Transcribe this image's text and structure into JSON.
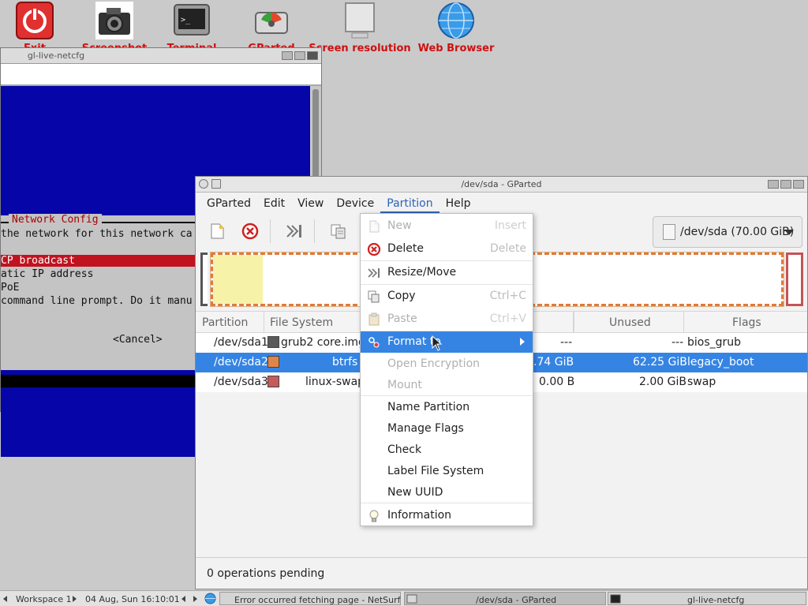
{
  "desktop": {
    "icons": [
      {
        "name": "exit-icon",
        "label": "Exit"
      },
      {
        "name": "screenshot-icon",
        "label": "Screenshot"
      },
      {
        "name": "terminal-icon",
        "label": "Terminal"
      },
      {
        "name": "gparted-icon",
        "label": "GParted"
      },
      {
        "name": "screen-resolution-icon",
        "label": "Screen resolution"
      },
      {
        "name": "web-browser-icon",
        "label": "Web Browser"
      }
    ]
  },
  "terminal": {
    "title": "gl-live-netcfg",
    "dialog_title": "Network Config",
    "lines": [
      "the network for this network ca",
      "CP broadcast",
      "atic IP address",
      "PoE",
      "command line prompt. Do it manu"
    ],
    "cancel": "<Cancel>"
  },
  "gparted": {
    "title": "/dev/sda - GParted",
    "menus": [
      "GParted",
      "Edit",
      "View",
      "Device",
      "Partition",
      "Help"
    ],
    "device": "/dev/sda (70.00 GiB)",
    "columns": [
      "Partition",
      "File System",
      "Unused",
      "Flags"
    ],
    "rows": [
      {
        "partition": "/dev/sda1",
        "fs": "grub2 core.img",
        "used": "---",
        "unused": "---",
        "flags": "bios_grub",
        "color": "#5a5a5a"
      },
      {
        "partition": "/dev/sda2",
        "fs": "btrfs",
        "used": ".74 GiB",
        "unused": "62.25 GiB",
        "flags": "legacy_boot",
        "color": "#e0844a"
      },
      {
        "partition": "/dev/sda3",
        "fs": "linux-swap",
        "used": "0.00 B",
        "unused": "2.00 GiB",
        "flags": "swap",
        "color": "#c45c5c"
      }
    ],
    "status": "0 operations pending"
  },
  "context_menu": {
    "items": [
      {
        "label": "New",
        "accel": "Insert"
      },
      {
        "label": "Delete",
        "accel": "Delete"
      },
      {
        "label": "Resize/Move",
        "accel": ""
      },
      {
        "label": "Copy",
        "accel": "Ctrl+C"
      },
      {
        "label": "Paste",
        "accel": "Ctrl+V"
      },
      {
        "label": "Format to",
        "accel": ""
      },
      {
        "label": "Open Encryption",
        "accel": ""
      },
      {
        "label": "Mount",
        "accel": ""
      },
      {
        "label": "Name Partition",
        "accel": ""
      },
      {
        "label": "Manage Flags",
        "accel": ""
      },
      {
        "label": "Check",
        "accel": ""
      },
      {
        "label": "Label File System",
        "accel": ""
      },
      {
        "label": "New UUID",
        "accel": ""
      },
      {
        "label": "Information",
        "accel": ""
      }
    ]
  },
  "taskbar": {
    "workspace": "Workspace 1",
    "datetime": "04 Aug, Sun 16:10:01",
    "tasks": [
      "Error occurred fetching page - NetSurf",
      "/dev/sda - GParted",
      "gl-live-netcfg"
    ]
  },
  "colors": {
    "accent": "#3584e4",
    "desktop_label": "#cc1111",
    "terminal_blue": "#0505a8",
    "terminal_highlight": "#c1121f"
  }
}
